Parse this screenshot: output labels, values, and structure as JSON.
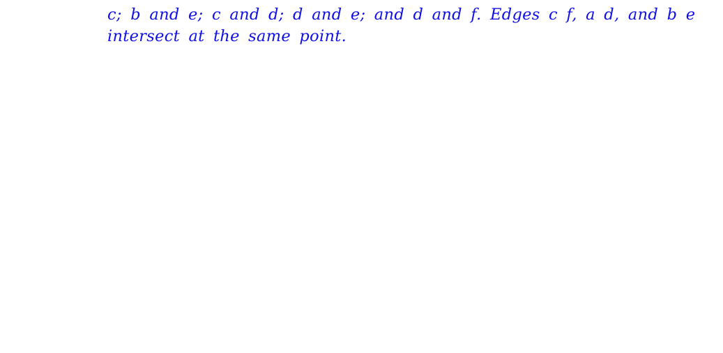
{
  "document": {
    "lines": [
      "c; b and e; c and d; d and e; and d and f.  Edges c f, a d, and b e",
      "intersect at the same point."
    ],
    "text_color": "#1010e6"
  }
}
